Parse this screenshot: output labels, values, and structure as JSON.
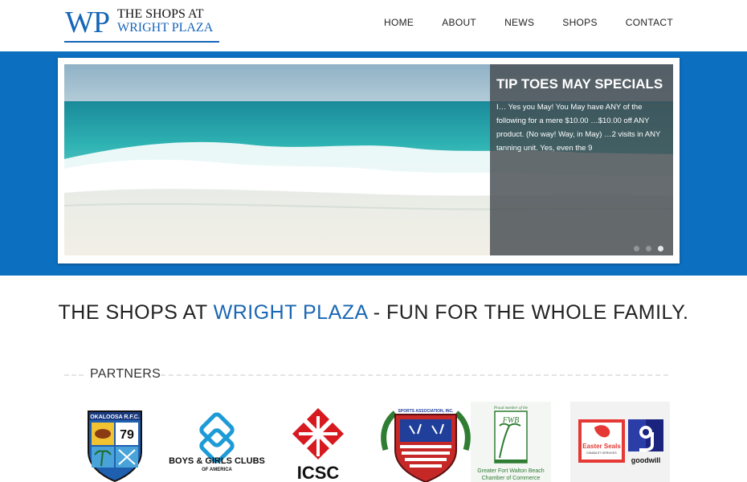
{
  "header": {
    "logo_mark": "WP",
    "logo_line1": "THE SHOPS AT",
    "logo_line2": "WRIGHT PLAZA"
  },
  "nav": [
    {
      "label": "HOME"
    },
    {
      "label": "ABOUT"
    },
    {
      "label": "NEWS"
    },
    {
      "label": "SHOPS"
    },
    {
      "label": "CONTACT"
    }
  ],
  "slider": {
    "title": "TIP TOES MAY SPECIALS",
    "text": "I… Yes you May! You May have ANY of the following for a mere $10.00 …$10.00 off ANY product. (No way! Way, in May) …2 visits in ANY tanning unit. Yes, even the 9",
    "slide_count": 3,
    "active_slide": 3
  },
  "tagline": {
    "part1": "THE SHOPS AT ",
    "highlight": "WRIGHT PLAZA",
    "part2": " - FUN FOR THE WHOLE FAMILY."
  },
  "partners": {
    "title": "PARTNERS",
    "items": [
      {
        "name": "okaloosa-rfc",
        "text_top": "OKALOOSA R.F.C.",
        "number": "79"
      },
      {
        "name": "boys-girls-clubs",
        "line1": "BOYS & GIRLS CLUBS",
        "line2": "OF AMERICA"
      },
      {
        "name": "icsc",
        "text": "ICSC"
      },
      {
        "name": "sports-association",
        "text": "SPORTS ASSOCIATION, INC."
      },
      {
        "name": "fwb-chamber",
        "top": "Proud member of the",
        "mark": "FWB",
        "line1": "Greater Fort Walton Beach",
        "line2": "Chamber of Commerce"
      },
      {
        "name": "easter-seals-goodwill",
        "es1": "Easter Seals",
        "es2": "DISABILITY SERVICES",
        "gw": "goodwill"
      }
    ]
  },
  "colors": {
    "brand_blue": "#1565b8",
    "hero_band": "#0c6fc0",
    "caption_overlay": "#464c50"
  }
}
